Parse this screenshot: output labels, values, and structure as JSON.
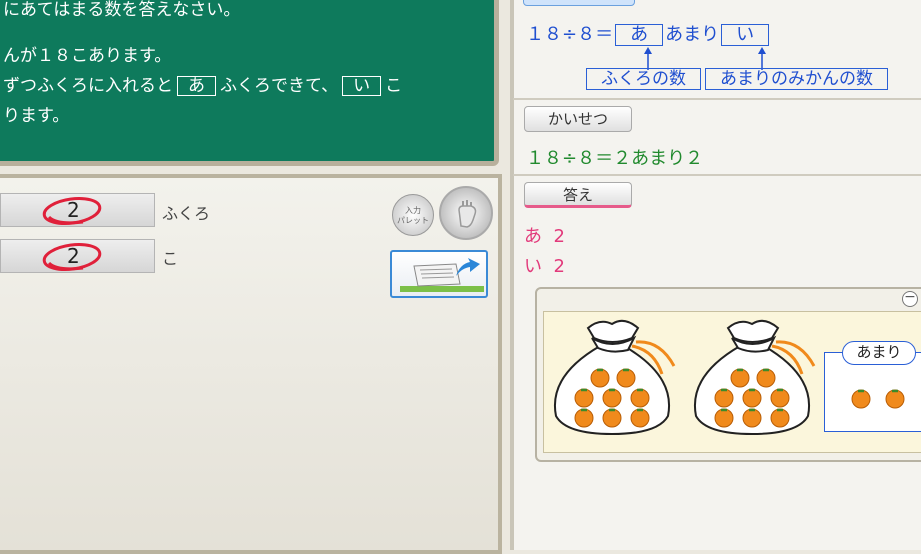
{
  "board": {
    "line1": "にあてはまる数を答えなさい。",
    "line2": "んが１８こあります。",
    "line3a": "ずつふくろに入れると",
    "box_a": "あ",
    "line3b": "ふくろできて、",
    "box_i": "い",
    "line3c": "こ",
    "line4": "ります。"
  },
  "answers": [
    {
      "value": "2",
      "unit": "ふくろ"
    },
    {
      "value": "2",
      "unit": "こ"
    }
  ],
  "palette_button": {
    "line1": "入力",
    "line2": "パレット"
  },
  "equation": {
    "left": "１８÷８＝",
    "box_a": "あ",
    "mid": "あまり",
    "box_i": "い",
    "label_a": "ふくろの数",
    "label_i": "あまりのみかんの数"
  },
  "explanation": {
    "button": "かいせつ",
    "text": "１８÷８＝２あまり２"
  },
  "answer_section": {
    "button": "答え",
    "row1_label": "あ",
    "row1_value": "2",
    "row2_label": "い",
    "row2_value": "2"
  },
  "figure": {
    "remainder_label": "あまり"
  },
  "colors": {
    "board": "#0e7a5c",
    "equation_blue": "#1f4fd0",
    "explanation_green": "#218a2e",
    "answer_pink": "#e23a7b",
    "orange": "#f08a1c"
  }
}
